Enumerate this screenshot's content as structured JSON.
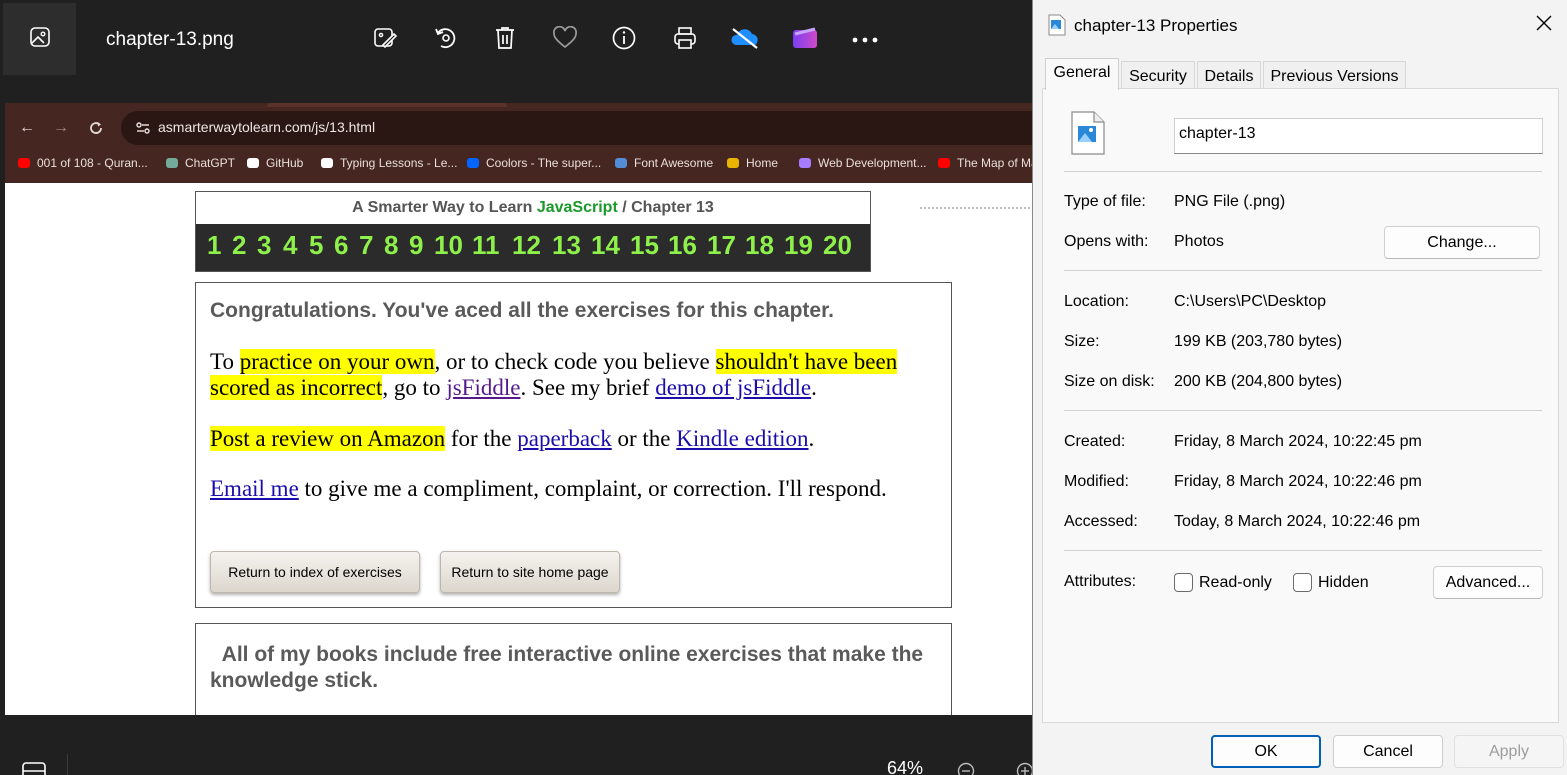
{
  "photos": {
    "filename": "chapter-13.png",
    "zoom": "64%",
    "toolbar": [
      "edit-image-icon",
      "rotate-icon",
      "delete-icon",
      "favorite-icon",
      "info-icon",
      "print-icon",
      "onedrive-icon",
      "clipchamp-icon",
      "more-icon"
    ]
  },
  "browser": {
    "url": "asmarterwaytolearn.com/js/13.html",
    "bookmarks": [
      {
        "label": "001 of 108 - Quran...",
        "icon": "youtube-icon",
        "color": "#ff0000"
      },
      {
        "label": "ChatGPT",
        "icon": "chatgpt-icon",
        "color": "#74aa9c"
      },
      {
        "label": "GitHub",
        "icon": "github-icon",
        "color": "#ffffff"
      },
      {
        "label": "Typing Lessons - Le...",
        "icon": "typing-icon",
        "color": "#ffffff"
      },
      {
        "label": "Coolors - The super...",
        "icon": "coolors-icon",
        "color": "#0066ff"
      },
      {
        "label": "Font Awesome",
        "icon": "flag-icon",
        "color": "#538dd7"
      },
      {
        "label": "Home",
        "icon": "home-image-icon",
        "color": "#e8b400"
      },
      {
        "label": "Web Development...",
        "icon": "webdev-icon",
        "color": "#a77cff"
      },
      {
        "label": "The Map of Ma",
        "icon": "youtube-icon",
        "color": "#ff0000"
      }
    ]
  },
  "webpage": {
    "header_prefix": "A Smarter Way to Learn",
    "header_js": "JavaScript",
    "header_suffix": "/  Chapter 13",
    "chapters": [
      "1",
      "2",
      "3",
      "4",
      "5",
      "6",
      "7",
      "8",
      "9",
      "10",
      "11",
      "12",
      "13",
      "14",
      "15",
      "16",
      "17",
      "18",
      "19",
      "20"
    ],
    "congrats_title": "Congratulations. You've aced all the exercises for this chapter.",
    "p1": {
      "t1": "To ",
      "h1": "practice on your own",
      "t2": ", or to check code you believe ",
      "h2": "shouldn't have been scored as incorrect",
      "t3": ", go to ",
      "l1": "jsFiddle",
      "t4": ". See my brief ",
      "l2": "demo of jsFiddle",
      "t5": "."
    },
    "p2": {
      "h1": "Post a review on Amazon",
      "t1": " for the ",
      "l1": "paperback",
      "t2": " or the ",
      "l2": "Kindle edition",
      "t3": "."
    },
    "p3": {
      "l1": "Email me",
      "t1": " to give me a compliment, complaint, or correction. I'll respond."
    },
    "btn_index": "Return to index of exercises",
    "btn_home": "Return to site home page",
    "books_text": "All of my books include free interactive online exercises that make the knowledge stick."
  },
  "dialog": {
    "title": "chapter-13 Properties",
    "tabs": [
      "General",
      "Security",
      "Details",
      "Previous Versions"
    ],
    "name": "chapter-13",
    "type_label": "Type of file:",
    "type_value": "PNG File (.png)",
    "opens_label": "Opens with:",
    "opens_value": "Photos",
    "change_btn": "Change...",
    "location_label": "Location:",
    "location_value": "C:\\Users\\PC\\Desktop",
    "size_label": "Size:",
    "size_value": "199 KB (203,780 bytes)",
    "disk_label": "Size on disk:",
    "disk_value": "200 KB (204,800 bytes)",
    "created_label": "Created:",
    "created_value": "Friday, 8 March 2024, 10:22:45 pm",
    "modified_label": "Modified:",
    "modified_value": "Friday, 8 March 2024, 10:22:46 pm",
    "accessed_label": "Accessed:",
    "accessed_value": "Today, 8 March 2024, 10:22:46 pm",
    "attributes_label": "Attributes:",
    "readonly": "Read-only",
    "hidden": "Hidden",
    "advanced_btn": "Advanced...",
    "ok": "OK",
    "cancel": "Cancel",
    "apply": "Apply"
  }
}
